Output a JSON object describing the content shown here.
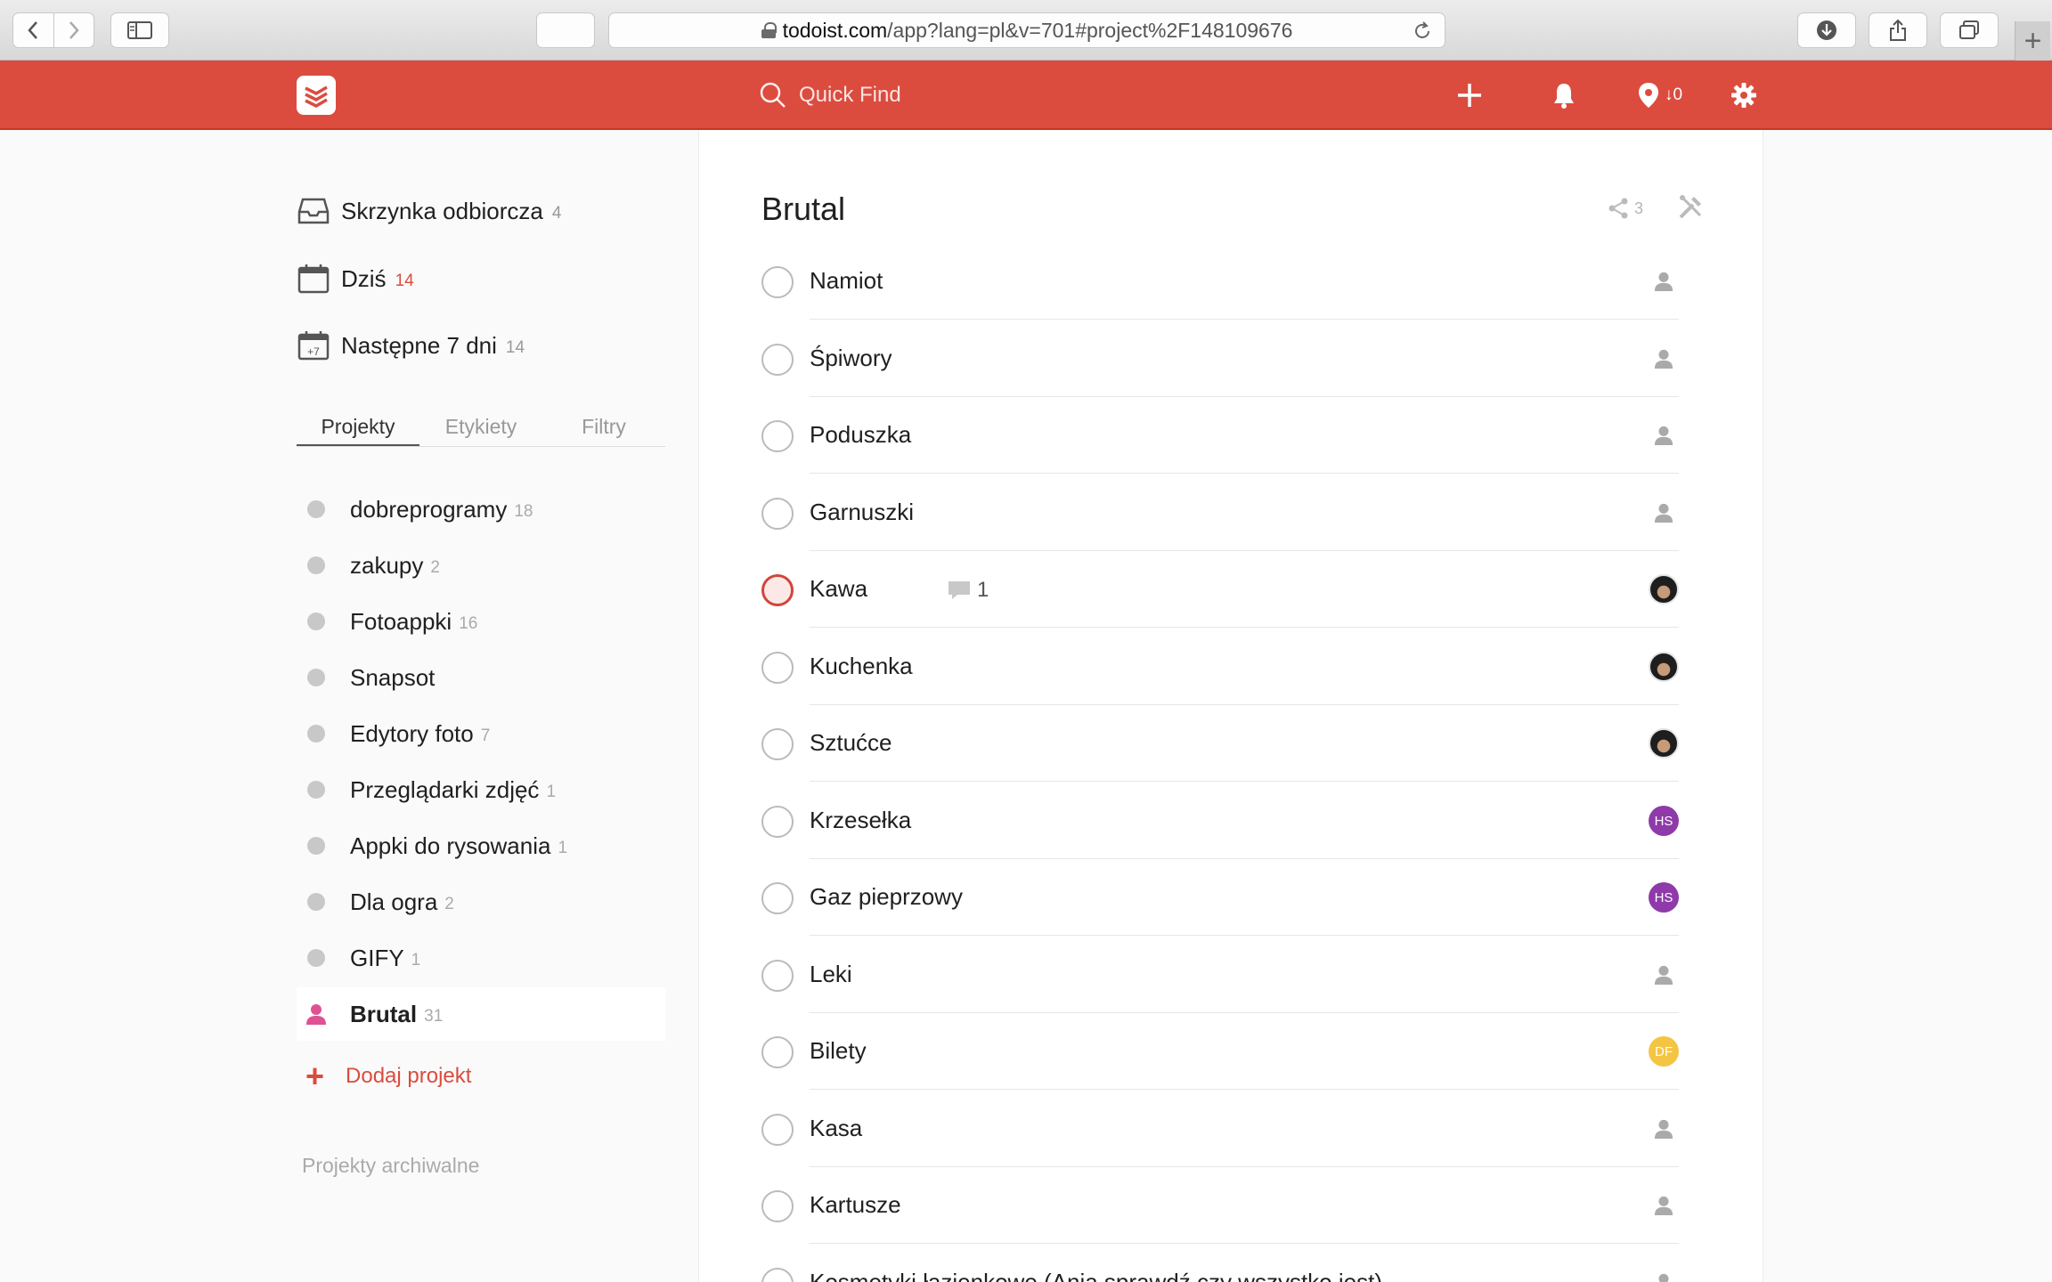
{
  "browser": {
    "url_host": "todoist.com",
    "url_path": "/app?lang=pl&v=701#project%2F148109676"
  },
  "header": {
    "search_placeholder": "Quick Find",
    "karma_label": "0"
  },
  "sidebar": {
    "fixed": [
      {
        "label": "Skrzynka odbiorcza",
        "count": "4",
        "icon": "inbox-icon"
      },
      {
        "label": "Dziś",
        "count": "14",
        "icon": "calendar-today-icon"
      },
      {
        "label": "Następne 7 dni",
        "count": "14",
        "icon": "calendar-next7-icon",
        "icon_text": "+7"
      }
    ],
    "tabs": [
      "Projekty",
      "Etykiety",
      "Filtry"
    ],
    "projects": [
      {
        "label": "dobreprogramy",
        "count": "18"
      },
      {
        "label": "zakupy",
        "count": "2"
      },
      {
        "label": "Fotoappki",
        "count": "16"
      },
      {
        "label": "Snapsot",
        "count": ""
      },
      {
        "label": "Edytory foto",
        "count": "7"
      },
      {
        "label": "Przeglądarki zdjęć",
        "count": "1"
      },
      {
        "label": "Appki do rysowania",
        "count": "1"
      },
      {
        "label": "Dla ogra",
        "count": "2"
      },
      {
        "label": "GIFY",
        "count": "1"
      },
      {
        "label": "Brutal",
        "count": "31"
      }
    ],
    "add_project": "Dodaj projekt",
    "archived": "Projekty archiwalne"
  },
  "main": {
    "title": "Brutal",
    "share_count": "3",
    "tasks": [
      {
        "name": "Namiot",
        "assignee": "person"
      },
      {
        "name": "Śpiwory",
        "assignee": "person"
      },
      {
        "name": "Poduszka",
        "assignee": "person"
      },
      {
        "name": "Garnuszki",
        "assignee": "person"
      },
      {
        "name": "Kawa",
        "assignee": "photo",
        "notes": "1",
        "priority": "p1"
      },
      {
        "name": "Kuchenka",
        "assignee": "photo"
      },
      {
        "name": "Sztućce",
        "assignee": "photo"
      },
      {
        "name": "Krzesełka",
        "assignee": "HS"
      },
      {
        "name": "Gaz pieprzowy",
        "assignee": "HS"
      },
      {
        "name": "Leki",
        "assignee": "person"
      },
      {
        "name": "Bilety",
        "assignee": "DF"
      },
      {
        "name": "Kasa",
        "assignee": "person"
      },
      {
        "name": "Kartusze",
        "assignee": "person"
      },
      {
        "name": "Kosmetyki łazienkowe (Ania sprawdź czy wszystko jest)",
        "assignee": "person"
      }
    ]
  },
  "colors": {
    "brand": "#db4c3f",
    "hs_avatar": "#8e3aa9",
    "df_avatar": "#f4c542",
    "brutal_icon": "#e05194"
  }
}
